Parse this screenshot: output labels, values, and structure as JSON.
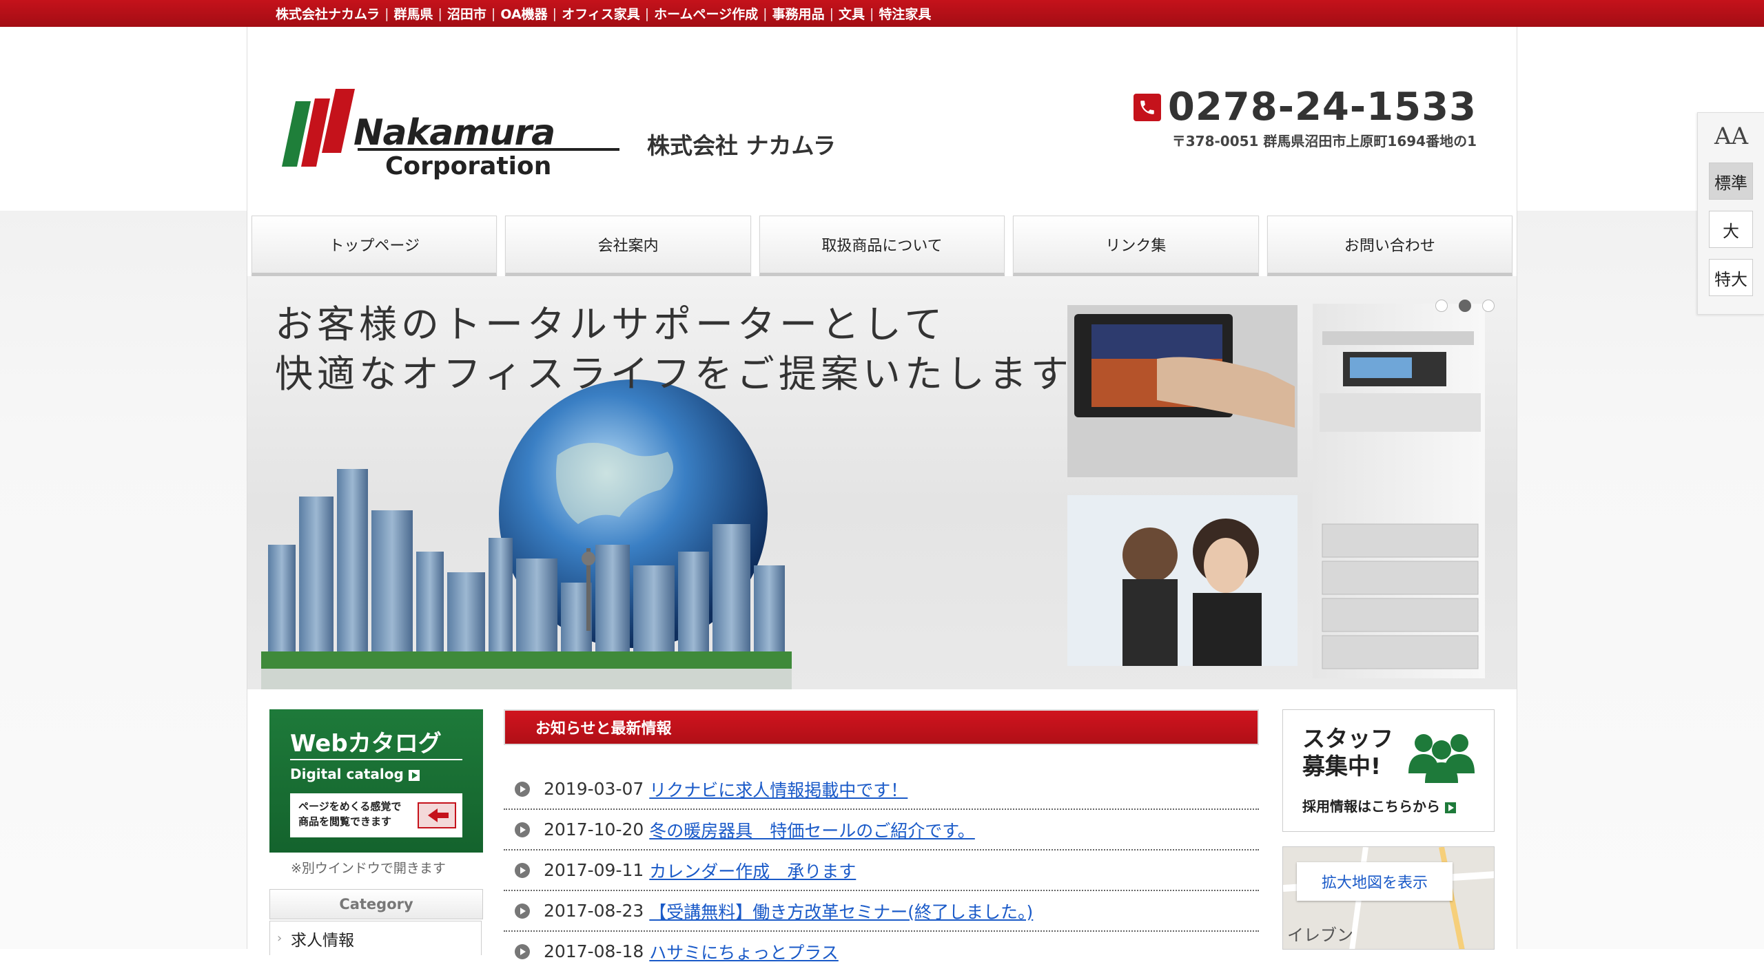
{
  "topbar": {
    "items": [
      "株式会社ナカムラ",
      "群馬県",
      "沼田市",
      "OA機器",
      "オフィス家具",
      "ホームページ作成",
      "事務用品",
      "文具",
      "特注家具"
    ]
  },
  "header": {
    "logo_name": "Nakamura",
    "logo_sub": "Corporation",
    "company_jp": "株式会社 ナカムラ",
    "tel": "0278-24-1533",
    "address": "〒378-0051 群馬県沼田市上原町1694番地の1",
    "logo_colors": {
      "green": "#1f7f3a",
      "red": "#c5121b"
    }
  },
  "nav": {
    "items": [
      "トップページ",
      "会社案内",
      "取扱商品について",
      "リンク集",
      "お問い合わせ"
    ]
  },
  "hero": {
    "line1": "お客様のトータルサポーターとして",
    "line2": "快適なオフィスライフをご提案いたします",
    "active_slide": 2,
    "slide_count": 3
  },
  "sidebar": {
    "webcat_title": "Webカタログ",
    "webcat_sub": "Digital catalog",
    "webcat_box_l1": "ページをめくる感覚で",
    "webcat_box_l2": "商品を閲覧できます",
    "note": "※別ウインドウで開きます",
    "category_head": "Category",
    "category_item": "求人情報"
  },
  "news": {
    "head": "お知らせと最新情報",
    "items": [
      {
        "date": "2019-03-07",
        "title": "リクナビに求人情報掲載中です！"
      },
      {
        "date": "2017-10-20",
        "title": "冬の暖房器具　特価セールのご紹介です。"
      },
      {
        "date": "2017-09-11",
        "title": "カレンダー作成　承ります"
      },
      {
        "date": "2017-08-23",
        "title": "【受講無料】働き方改革セミナー(終了しました。)"
      },
      {
        "date": "2017-08-18",
        "title": "ハサミにちょっとプラス"
      }
    ]
  },
  "right": {
    "staff_l1": "スタッフ",
    "staff_l2": "募集中!",
    "staff_link": "採用情報はこちらから",
    "map_button": "拡大地図を表示",
    "map_label": "イレブン"
  },
  "fontsize": {
    "label": "AA",
    "options": [
      "標準",
      "大",
      "特大"
    ],
    "selected": "標準"
  }
}
